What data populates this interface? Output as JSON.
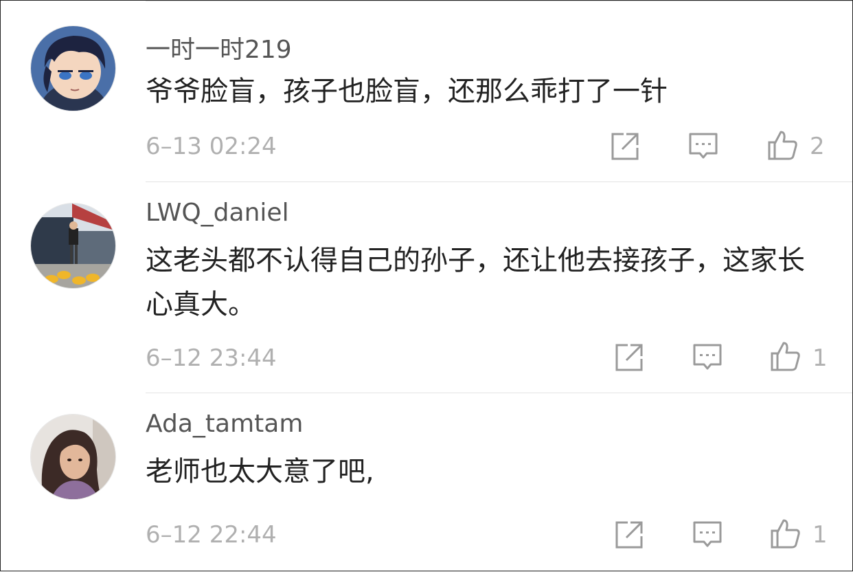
{
  "comments": [
    {
      "username": "一时一时219",
      "text": "爷爷脸盲，孩子也脸盲，还那么乖打了一针",
      "time": "6–13 02:24",
      "likes": "2",
      "avatar": "anime-boy-avatar"
    },
    {
      "username": "LWQ_daniel",
      "text": "这老头都不认得自己的孙子，还让他去接孩子，这家长心真大。",
      "time": "6–12 23:44",
      "likes": "1",
      "avatar": "street-photo-avatar"
    },
    {
      "username": "Ada_tamtam",
      "text": "老师也太大意了吧,",
      "time": "6–12 22:44",
      "likes": "1",
      "avatar": "woman-portrait-avatar"
    }
  ],
  "icons": {
    "share": "share-icon",
    "reply": "comment-icon",
    "like": "thumbs-up-icon"
  },
  "colors": {
    "text": "#222222",
    "username": "#555555",
    "meta": "#b0b0b0",
    "divider": "#e3e3e3"
  }
}
